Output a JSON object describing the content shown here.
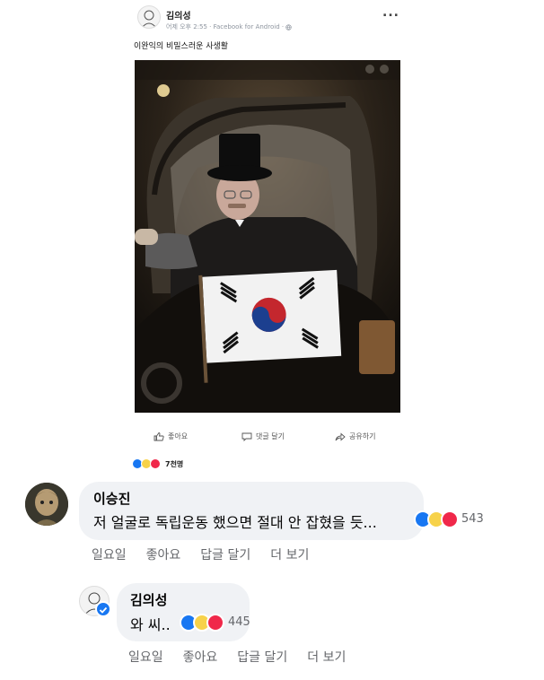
{
  "post": {
    "author": "김의성",
    "meta": "어제 오후 2:55 · Facebook for Android · ",
    "privacy_icon": "globe-icon",
    "text": "이완익의 비밀스러운 사생활",
    "more_label": "...",
    "actions": {
      "like": "좋아요",
      "comment": "댓글 달기",
      "share": "공유하기"
    },
    "reaction_count": "7천명"
  },
  "comments": [
    {
      "author": "이승진",
      "text": "저 얼굴로 독립운동 했으면 절대 안 잡혔을 듯...",
      "reaction_count": "543",
      "links": {
        "time": "일요일",
        "like": "좋아요",
        "reply": "답글 달기",
        "more": "더 보기"
      }
    },
    {
      "author": "김의성",
      "text": "와 씨..",
      "reaction_count": "445",
      "links": {
        "time": "일요일",
        "like": "좋아요",
        "reply": "답글 달기",
        "more": "더 보기"
      }
    }
  ],
  "colors": {
    "like": "#1877f2",
    "haha": "#f7d24a",
    "love": "#f0284a",
    "bubble": "#f0f2f5",
    "secondary_text": "#65676b"
  }
}
